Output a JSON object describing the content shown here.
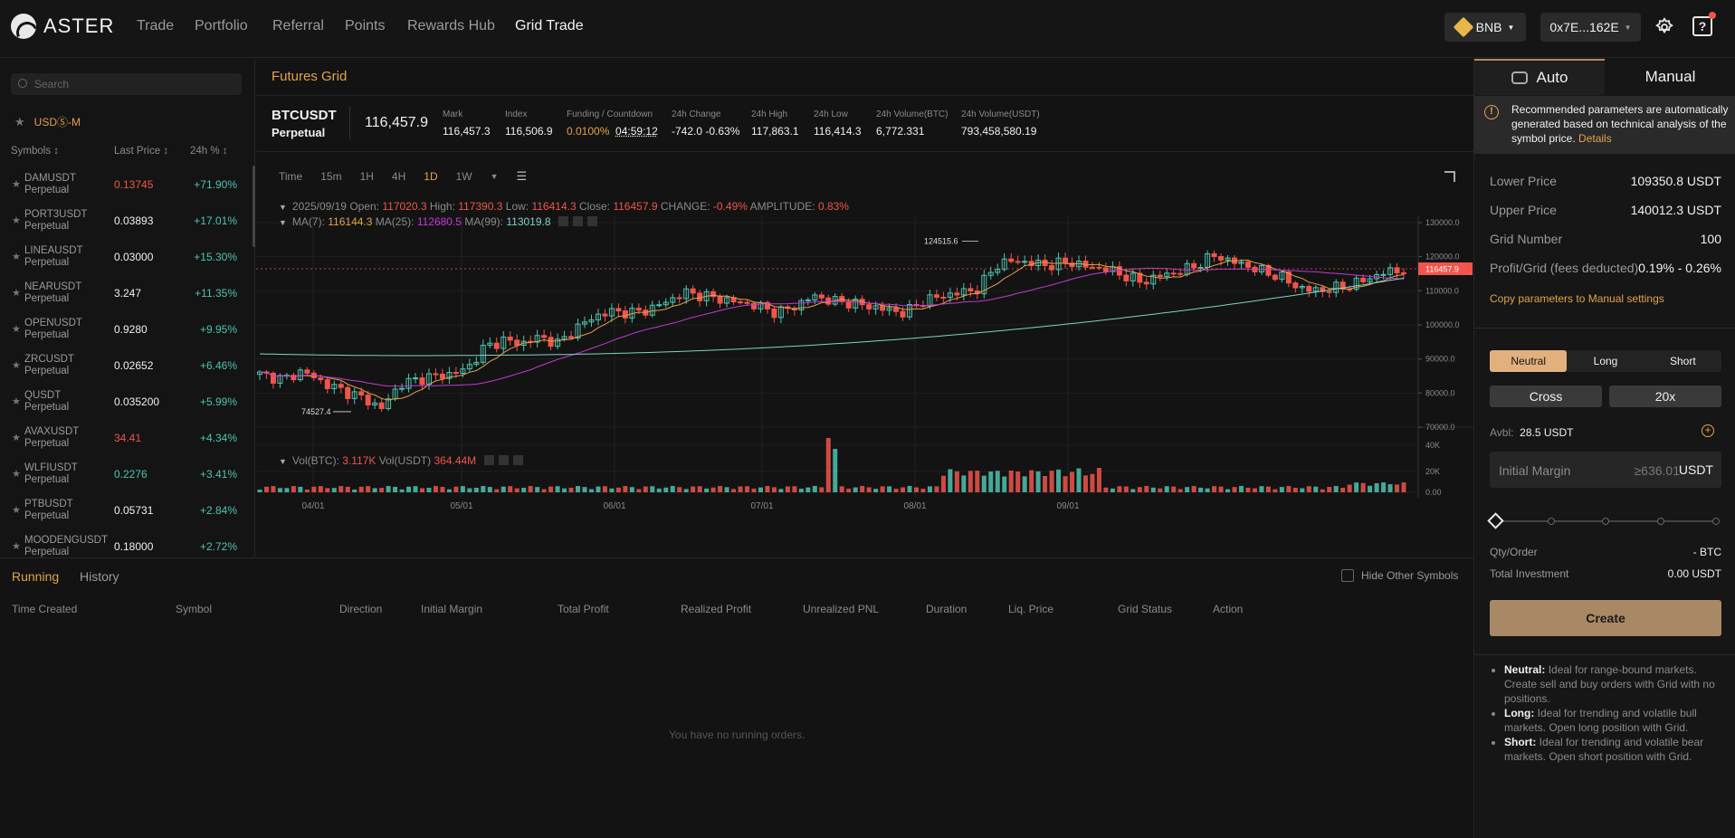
{
  "app": {
    "name": "ASTER"
  },
  "nav": [
    {
      "label": "Trade"
    },
    {
      "label": "Portfolio"
    },
    {
      "label": "Referral"
    },
    {
      "label": "Points"
    },
    {
      "label": "Rewards Hub"
    },
    {
      "label": "Grid Trade"
    }
  ],
  "header": {
    "chain": "BNB",
    "wallet": "0x7E...162E"
  },
  "left": {
    "search_placeholder": "Search",
    "market_tab": "USDⓈ-M",
    "col_symbols": "Symbols ↕",
    "col_last": "Last Price ↕",
    "col_change": "24h % ↕",
    "rows": [
      {
        "symbol": "DAMUSDT",
        "sub": "Perpetual",
        "price": "0.13745",
        "price_color": "#f0554b",
        "change": "+71.90%"
      },
      {
        "symbol": "PORT3USDT",
        "sub": "Perpetual",
        "price": "0.03893",
        "price_color": "#f0f0f0",
        "change": "+17.01%"
      },
      {
        "symbol": "LINEAUSDT",
        "sub": "Perpetual",
        "price": "0.03000",
        "price_color": "#f0f0f0",
        "change": "+15.30%"
      },
      {
        "symbol": "NEARUSDT",
        "sub": "Perpetual",
        "price": "3.247",
        "price_color": "#f0f0f0",
        "change": "+11.35%"
      },
      {
        "symbol": "OPENUSDT",
        "sub": "Perpetual",
        "price": "0.9280",
        "price_color": "#f0f0f0",
        "change": "+9.95%"
      },
      {
        "symbol": "ZRCUSDT",
        "sub": "Perpetual",
        "price": "0.02652",
        "price_color": "#f0f0f0",
        "change": "+6.46%"
      },
      {
        "symbol": "QUSDT",
        "sub": "Perpetual",
        "price": "0.035200",
        "price_color": "#f0f0f0",
        "change": "+5.99%"
      },
      {
        "symbol": "AVAXUSDT",
        "sub": "Perpetual",
        "price": "34.41",
        "price_color": "#f0554b",
        "change": "+4.34%"
      },
      {
        "symbol": "WLFIUSDT",
        "sub": "Perpetual",
        "price": "0.2276",
        "price_color": "#4fc3b1",
        "change": "+3.41%"
      },
      {
        "symbol": "PTBUSDT",
        "sub": "Perpetual",
        "price": "0.05731",
        "price_color": "#f0f0f0",
        "change": "+2.84%"
      },
      {
        "symbol": "MOODENGUSDT",
        "sub": "Perpetual",
        "price": "0.18000",
        "price_color": "#f0f0f0",
        "change": "+2.72%"
      }
    ]
  },
  "center": {
    "title": "Futures Grid",
    "ticker": {
      "symbol": "BTCUSDT",
      "type": "Perpetual",
      "last": "116,457.9",
      "stats": [
        {
          "label": "Mark",
          "value": "116,457.3"
        },
        {
          "label": "Index",
          "value": "116,506.9"
        },
        {
          "label": "Funding / Countdown",
          "value": "0.0100%",
          "value2": "04:59:12"
        },
        {
          "label": "24h Change",
          "value": "-742.0 -0.63%"
        },
        {
          "label": "24h High",
          "value": "117,863.1"
        },
        {
          "label": "24h Low",
          "value": "116,414.3"
        },
        {
          "label": "24h Volume(BTC)",
          "value": "6,772.331"
        },
        {
          "label": "24h Volume(USDT)",
          "value": "793,458,580.19"
        }
      ]
    },
    "intervals": [
      "Time",
      "15m",
      "1H",
      "4H",
      "1D",
      "1W"
    ],
    "active_interval": "1D",
    "ohlc": {
      "date": "2025/09/19",
      "open_label": "Open:",
      "open": "117020.3",
      "high_label": "High:",
      "high": "117390.3",
      "low_label": "Low:",
      "low": "116414.3",
      "close_label": "Close:",
      "close": "116457.9",
      "change_label": "CHANGE:",
      "change": "-0.49%",
      "amp_label": "AMPLITUDE:",
      "amp": "0.83%"
    },
    "ma": {
      "ma7_label": "MA(7):",
      "ma7": "116144.3",
      "ma25_label": "MA(25):",
      "ma25": "112680.5",
      "ma99_label": "MA(99):",
      "ma99": "113019.8"
    },
    "vol": {
      "btc_label": "Vol(BTC):",
      "btc": "3.117K",
      "usdt_label": "Vol(USDT)",
      "usdt": "364.44M"
    },
    "price_tag": "116457.9",
    "high_marker": "124515.6",
    "low_marker": "74527.4"
  },
  "chart_data": {
    "type": "candlestick",
    "y_ticks": [
      "130000.0",
      "120000.0",
      "110000.0",
      "100000.0",
      "90000.0",
      "80000.0",
      "70000.0"
    ],
    "ylim": [
      70000,
      130000
    ],
    "vol_ticks": [
      "40K",
      "20K",
      "0.00"
    ],
    "x_ticks": [
      "04/01",
      "05/01",
      "06/01",
      "07/01",
      "08/01",
      "09/01"
    ],
    "series": [
      {
        "name": "MA(7)",
        "color": "#e2a34a"
      },
      {
        "name": "MA(25)",
        "color": "#c23ad6"
      },
      {
        "name": "MA(99)",
        "color": "#7fd3c8"
      }
    ],
    "close_path": [
      [
        0,
        85500
      ],
      [
        8,
        84000
      ],
      [
        14,
        86500
      ],
      [
        22,
        82500
      ],
      [
        28,
        80500
      ],
      [
        34,
        78500
      ],
      [
        40,
        75500
      ],
      [
        46,
        82500
      ],
      [
        54,
        84500
      ],
      [
        62,
        85500
      ],
      [
        68,
        87000
      ],
      [
        74,
        93500
      ],
      [
        80,
        95500
      ],
      [
        86,
        94500
      ],
      [
        92,
        96500
      ],
      [
        98,
        94500
      ],
      [
        104,
        99000
      ],
      [
        110,
        102500
      ],
      [
        116,
        104000
      ],
      [
        122,
        103500
      ],
      [
        128,
        104500
      ],
      [
        134,
        107000
      ],
      [
        140,
        109500
      ],
      [
        146,
        108500
      ],
      [
        152,
        107500
      ],
      [
        158,
        106500
      ],
      [
        164,
        105500
      ],
      [
        170,
        103500
      ],
      [
        176,
        105500
      ],
      [
        182,
        108500
      ],
      [
        188,
        107000
      ],
      [
        194,
        106500
      ],
      [
        200,
        105500
      ],
      [
        206,
        104500
      ],
      [
        212,
        103500
      ],
      [
        218,
        107000
      ],
      [
        224,
        108500
      ],
      [
        230,
        109500
      ],
      [
        236,
        110500
      ],
      [
        242,
        117500
      ],
      [
        248,
        119000
      ],
      [
        254,
        118000
      ],
      [
        260,
        117500
      ],
      [
        266,
        118500
      ],
      [
        272,
        117000
      ],
      [
        278,
        116500
      ],
      [
        284,
        114500
      ],
      [
        290,
        112500
      ],
      [
        296,
        114500
      ],
      [
        302,
        115500
      ],
      [
        308,
        117500
      ],
      [
        314,
        120500
      ],
      [
        318,
        119000
      ],
      [
        324,
        117500
      ],
      [
        330,
        115500
      ],
      [
        336,
        114000
      ],
      [
        340,
        111500
      ],
      [
        346,
        110000
      ],
      [
        352,
        110500
      ],
      [
        358,
        111500
      ],
      [
        364,
        113500
      ],
      [
        370,
        115500
      ],
      [
        376,
        116200
      ]
    ],
    "volume_note": "daily BTC volume bars; spike near 05/20",
    "ohlc_last": {
      "open": 117020.3,
      "high": 117390.3,
      "low": 116414.3,
      "close": 116457.9
    }
  },
  "orders": {
    "tab_running": "Running",
    "tab_history": "History",
    "hide_other": "Hide Other Symbols",
    "columns": [
      "Time Created",
      "Symbol",
      "Direction",
      "Initial Margin",
      "Total Profit",
      "Realized Profit",
      "Unrealized PNL",
      "Duration",
      "Liq. Price",
      "Grid Status",
      "Action"
    ],
    "empty": "You have no running orders."
  },
  "right": {
    "tab_auto": "Auto",
    "tab_manual": "Manual",
    "notice": "Recommended parameters are automatically generated based on technical analysis of the symbol price.",
    "notice_link": "Details",
    "params": [
      {
        "k": "Lower Price",
        "v": "109350.8 USDT"
      },
      {
        "k": "Upper Price",
        "v": "140012.3 USDT"
      },
      {
        "k": "Grid Number",
        "v": "100"
      },
      {
        "k": "Profit/Grid (fees deducted)",
        "v": "0.19% - 0.26%"
      }
    ],
    "copy_link": "Copy parameters to Manual settings",
    "directions": [
      "Neutral",
      "Long",
      "Short"
    ],
    "margin_mode": "Cross",
    "leverage": "20x",
    "avbl_label": "Avbl:",
    "avbl_value": "28.5 USDT",
    "im_placeholder": "Initial Margin",
    "im_hint": "≥636.01",
    "im_unit": "USDT",
    "qty_label": "Qty/Order",
    "qty_value": "- BTC",
    "total_label": "Total Investment",
    "total_value": "0.00 USDT",
    "create": "Create",
    "tips": [
      {
        "title": "Neutral:",
        "text": "Ideal for range-bound markets. Create sell and buy orders with Grid with no positions."
      },
      {
        "title": "Long:",
        "text": "Ideal for trending and volatile bull markets. Open long position with Grid."
      },
      {
        "title": "Short:",
        "text": "Ideal for trending and volatile bear markets. Open short position with Grid."
      }
    ]
  }
}
